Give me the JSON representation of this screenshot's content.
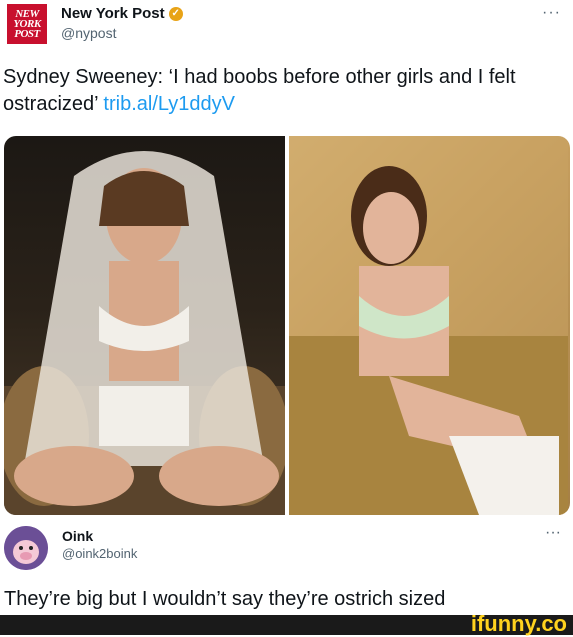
{
  "post": {
    "author_name": "New York Post",
    "handle": "@nypost",
    "logo_text": [
      "NEW",
      "YORK",
      "POST"
    ],
    "more": "···",
    "text": "Sydney Sweeney: ‘I had boobs before other girls and I felt ostracized’",
    "link": "trib.al/Ly1ddyV"
  },
  "media": [
    {
      "icon": "photo-woman-white-lace-veil"
    },
    {
      "icon": "photo-woman-on-gold-couch"
    }
  ],
  "reply": {
    "author_name": "Oink",
    "handle": "@oink2boink",
    "more": "···",
    "text": "They’re big but I wouldn’t say they’re ostrich sized"
  },
  "watermark": "ifunny.co",
  "colors": {
    "link": "#1d9bf0",
    "logo_red": "#c8102e",
    "verified_gold": "#e8a317",
    "watermark_yellow": "#ffd21e"
  }
}
